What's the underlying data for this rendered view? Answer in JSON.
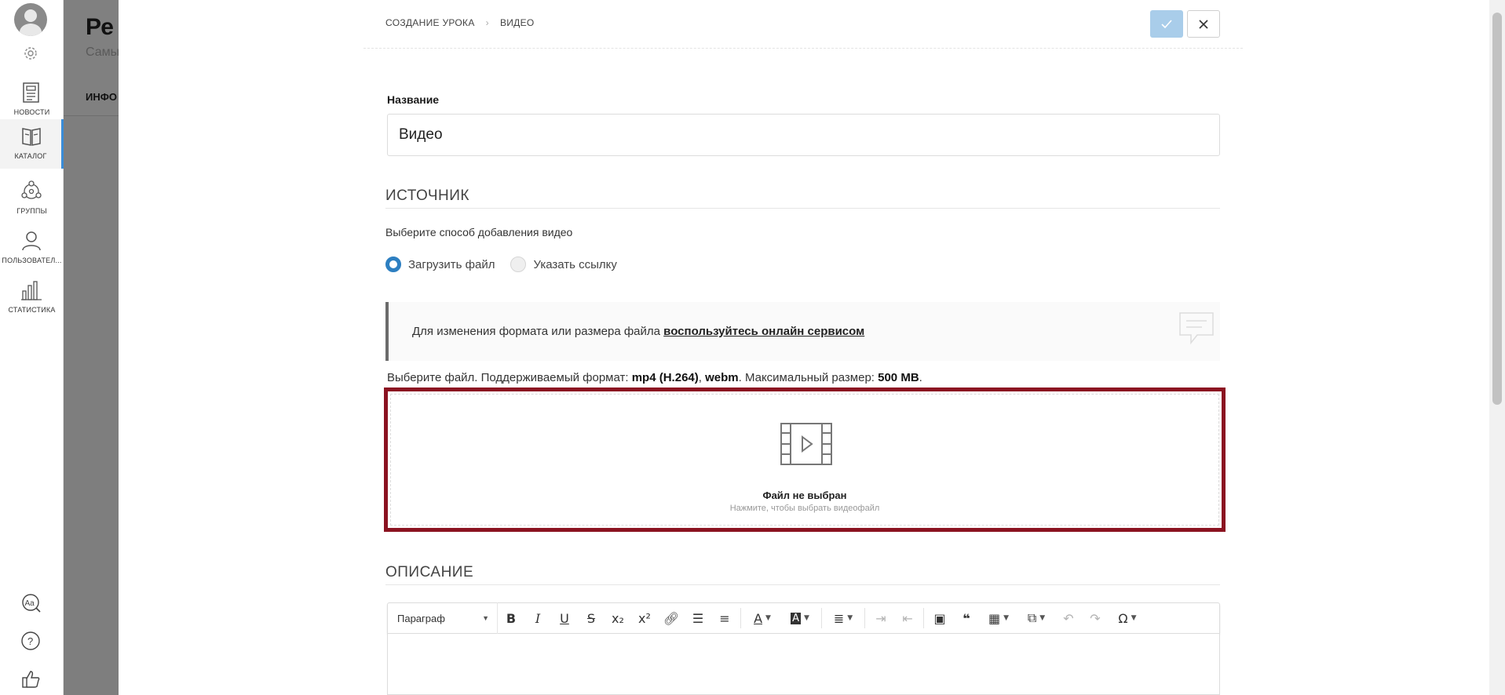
{
  "sidebar": {
    "items": [
      {
        "label": "НОВОСТИ",
        "icon": "newspaper-icon"
      },
      {
        "label": "КАТАЛОГ",
        "icon": "book-icon",
        "active": true
      },
      {
        "label": "ГРУППЫ",
        "icon": "groups-icon"
      },
      {
        "label": "ПОЛЬЗОВАТЕЛ...",
        "icon": "user-icon"
      },
      {
        "label": "СТАТИСТИКА",
        "icon": "bar-chart-icon"
      }
    ],
    "bottom_icons": [
      "spellcheck-icon",
      "help-icon",
      "thumbs-up-icon"
    ]
  },
  "background_page": {
    "title": "Ре",
    "subtitle": "Самы",
    "tab": "ИНФО"
  },
  "header": {
    "breadcrumb": [
      "СОЗДАНИЕ УРОКА",
      "ВИДЕО"
    ],
    "accent_color": "#a9cdea"
  },
  "form": {
    "name_label": "Название",
    "name_value": "Видео",
    "source_title": "ИСТОЧНИК",
    "source_hint": "Выберите способ добавления видео",
    "radio_upload": "Загрузить файл",
    "radio_link": "Указать ссылку",
    "selected": "upload",
    "info_text": "Для изменения формата или размера файла",
    "info_link": "воспользуйтесь онлайн сервисом",
    "format_prefix": "Выберите файл. Поддерживаемый формат:",
    "format_1": "mp4 (H.264)",
    "format_sep": ",",
    "format_2": "webm",
    "size_prefix": ". Максимальный размер:",
    "size_value": "500 MB",
    "size_suffix": ".",
    "dropzone_title": "Файл не выбран",
    "dropzone_hint": "Нажмите, чтобы выбрать видеофайл",
    "dropzone_border_color": "#8b1321",
    "description_title": "ОПИСАНИЕ"
  },
  "editor": {
    "paragraph_label": "Параграф"
  }
}
